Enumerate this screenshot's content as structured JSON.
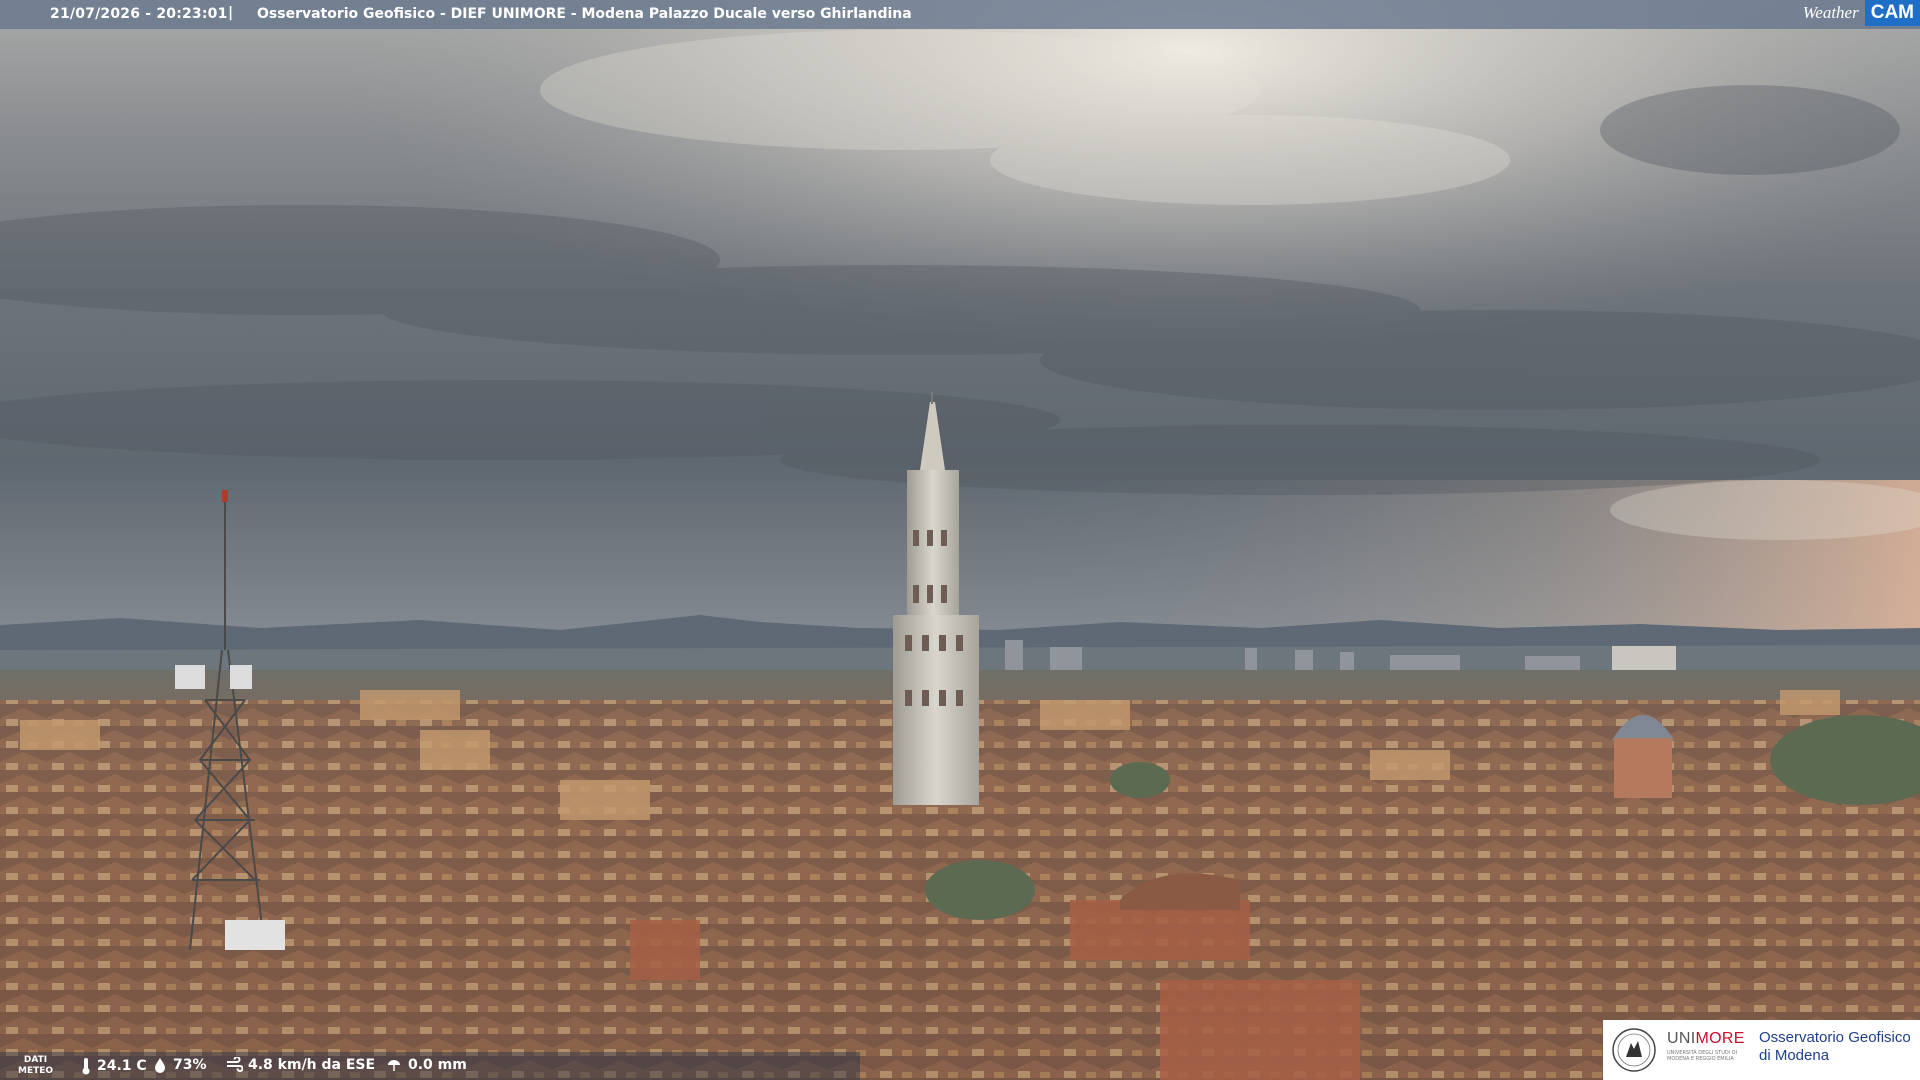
{
  "header": {
    "datetime": "21/07/2026 - 20:23:01",
    "separator": "|",
    "title": "Osservatorio Geofisico - DIEF UNIMORE - Modena Palazzo Ducale verso Ghirlandina",
    "logo_weather": "Weather",
    "logo_cam": "CAM"
  },
  "meteo": {
    "label_line1": "DATI",
    "label_line2": "METEO",
    "temperature": "24.1 C",
    "humidity": "73%",
    "wind": "4.8 km/h da ESE",
    "rain": "0.0 mm",
    "icons": [
      "thermometer-icon",
      "humidity-drop-icon",
      "wind-icon",
      "rain-icon"
    ]
  },
  "footer_logo": {
    "brand_uni": "UNI",
    "brand_more": "MORE",
    "brand_sub_line1": "UNIVERSITÀ DEGLI STUDI DI",
    "brand_sub_line2": "MODENA E REGGIO EMILIA",
    "observatory_line1": "Osservatorio Geofisico",
    "observatory_line2": "di Modena"
  },
  "colors": {
    "topbar": "#64748c",
    "cam_accent": "#1f6fc7",
    "unimore_red": "#c8102e",
    "observatory_blue": "#1d3f8a"
  }
}
